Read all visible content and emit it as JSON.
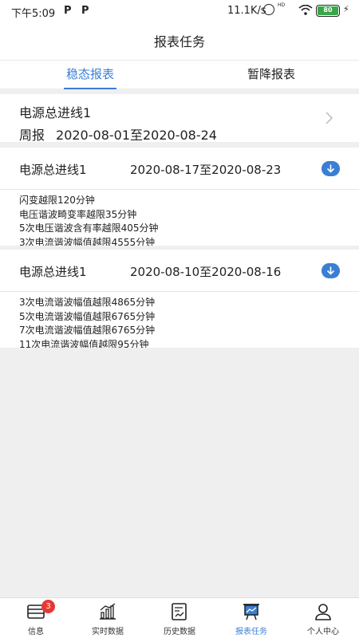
{
  "status_bar": {
    "time": "下午5:09",
    "notification_icons": [
      "P",
      "P"
    ],
    "network_speed": "11.1K/s",
    "hd_label": "HD",
    "battery_level": "80",
    "battery_color": "#3aa64a"
  },
  "header": {
    "title": "报表任务"
  },
  "tabs": [
    {
      "label": "稳态报表",
      "active": true
    },
    {
      "label": "暂降报表",
      "active": false
    }
  ],
  "summary": {
    "line_name": "电源总进线1",
    "report_type": "周报",
    "date_range": "2020-08-01至2020-08-24"
  },
  "reports": [
    {
      "name": "电源总进线1",
      "range": "2020-08-17至2020-08-23",
      "items": [
        "闪变越限120分钟",
        "电压谐波畸变率越限35分钟",
        "5次电压谐波含有率越限405分钟",
        "3次电流谐波幅值越限4555分钟"
      ]
    },
    {
      "name": "电源总进线1",
      "range": "2020-08-10至2020-08-16",
      "items": [
        "3次电流谐波幅值越限4865分钟",
        "5次电流谐波幅值越限6765分钟",
        "7次电流谐波幅值越限6765分钟",
        "11次电流谐波幅值越限95分钟"
      ]
    }
  ],
  "bottom_nav": [
    {
      "label": "信息",
      "icon": "message-icon",
      "badge": "3",
      "active": false
    },
    {
      "label": "实时数据",
      "icon": "realtime-chart-icon",
      "active": false
    },
    {
      "label": "历史数据",
      "icon": "history-data-icon",
      "active": false
    },
    {
      "label": "报表任务",
      "icon": "report-board-icon",
      "active": true
    },
    {
      "label": "个人中心",
      "icon": "person-icon",
      "active": false
    }
  ],
  "colors": {
    "accent": "#3b7fd4",
    "badge": "#e53935",
    "background": "#efefef"
  }
}
